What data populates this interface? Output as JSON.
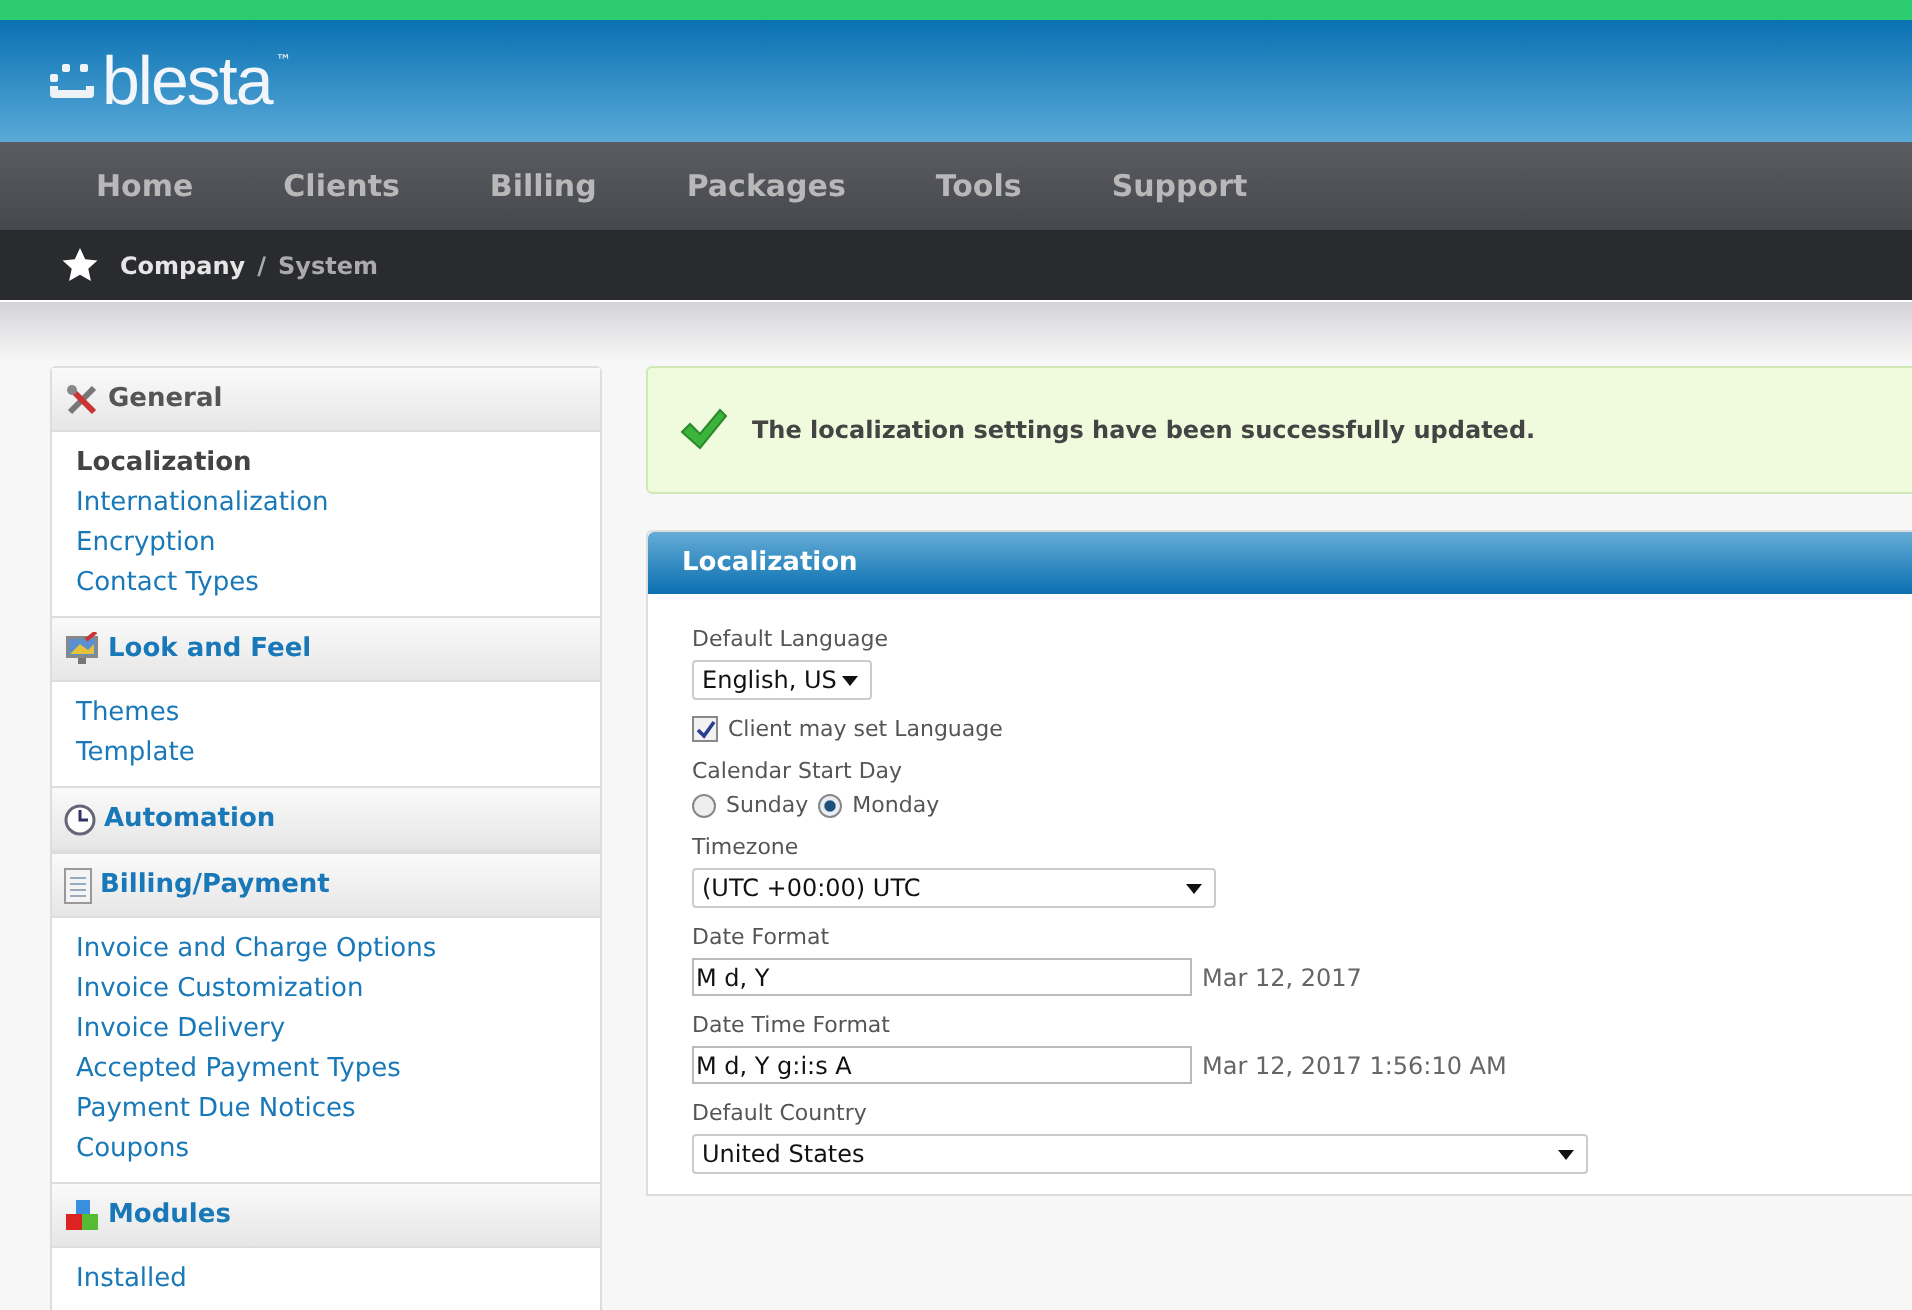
{
  "logo": {
    "name": "blesta",
    "mark": "™"
  },
  "nav": [
    {
      "label": "Home",
      "selected": false
    },
    {
      "label": "Clients",
      "selected": false
    },
    {
      "label": "Billing",
      "selected": false
    },
    {
      "label": "Packages",
      "selected": false
    },
    {
      "label": "Tools",
      "selected": false
    },
    {
      "label": "Support",
      "selected": false
    }
  ],
  "breadcrumb": {
    "parent": "Company",
    "separator": "/",
    "current": "System"
  },
  "sidebar": [
    {
      "title": "General",
      "selected": true,
      "items": [
        {
          "label": "Localization",
          "selected": true
        },
        {
          "label": "Internationalization",
          "selected": false
        },
        {
          "label": "Encryption",
          "selected": false
        },
        {
          "label": "Contact Types",
          "selected": false
        }
      ]
    },
    {
      "title": "Look and Feel",
      "selected": false,
      "items": [
        {
          "label": "Themes",
          "selected": false
        },
        {
          "label": "Template",
          "selected": false
        }
      ]
    },
    {
      "title": "Automation",
      "selected": false
    },
    {
      "title": "Billing/Payment",
      "selected": false,
      "items": [
        {
          "label": "Invoice and Charge Options",
          "selected": false
        },
        {
          "label": "Invoice Customization",
          "selected": false
        },
        {
          "label": "Invoice Delivery",
          "selected": false
        },
        {
          "label": "Accepted Payment Types",
          "selected": false
        },
        {
          "label": "Payment Due Notices",
          "selected": false
        },
        {
          "label": "Coupons",
          "selected": false
        }
      ]
    },
    {
      "title": "Modules",
      "selected": false,
      "items": [
        {
          "label": "Installed",
          "selected": false
        }
      ]
    }
  ],
  "message": {
    "text": "The localization settings have been successfully updated."
  },
  "panel": {
    "title": "Localization",
    "fields": [
      {
        "kind": "select",
        "label": "Default Language",
        "value": "English, US"
      },
      {
        "kind": "checkbox",
        "label": "Client may set Language",
        "checked": true
      },
      {
        "kind": "radio",
        "label": "Calendar Start Day",
        "options": [
          {
            "label": "Sunday",
            "selected": false
          },
          {
            "label": "Monday",
            "selected": true
          }
        ]
      },
      {
        "kind": "select",
        "label": "Timezone",
        "value": "(UTC +00:00) UTC"
      },
      {
        "kind": "text",
        "label": "Date Format",
        "value": "M d, Y",
        "preview": "Mar 12, 2017"
      },
      {
        "kind": "text",
        "label": "Date Time Format",
        "value": "M d, Y g:i:s A",
        "preview": "Mar 12, 2017 1:56:10 AM"
      },
      {
        "kind": "select",
        "label": "Default Country",
        "value": "United States"
      }
    ]
  }
}
